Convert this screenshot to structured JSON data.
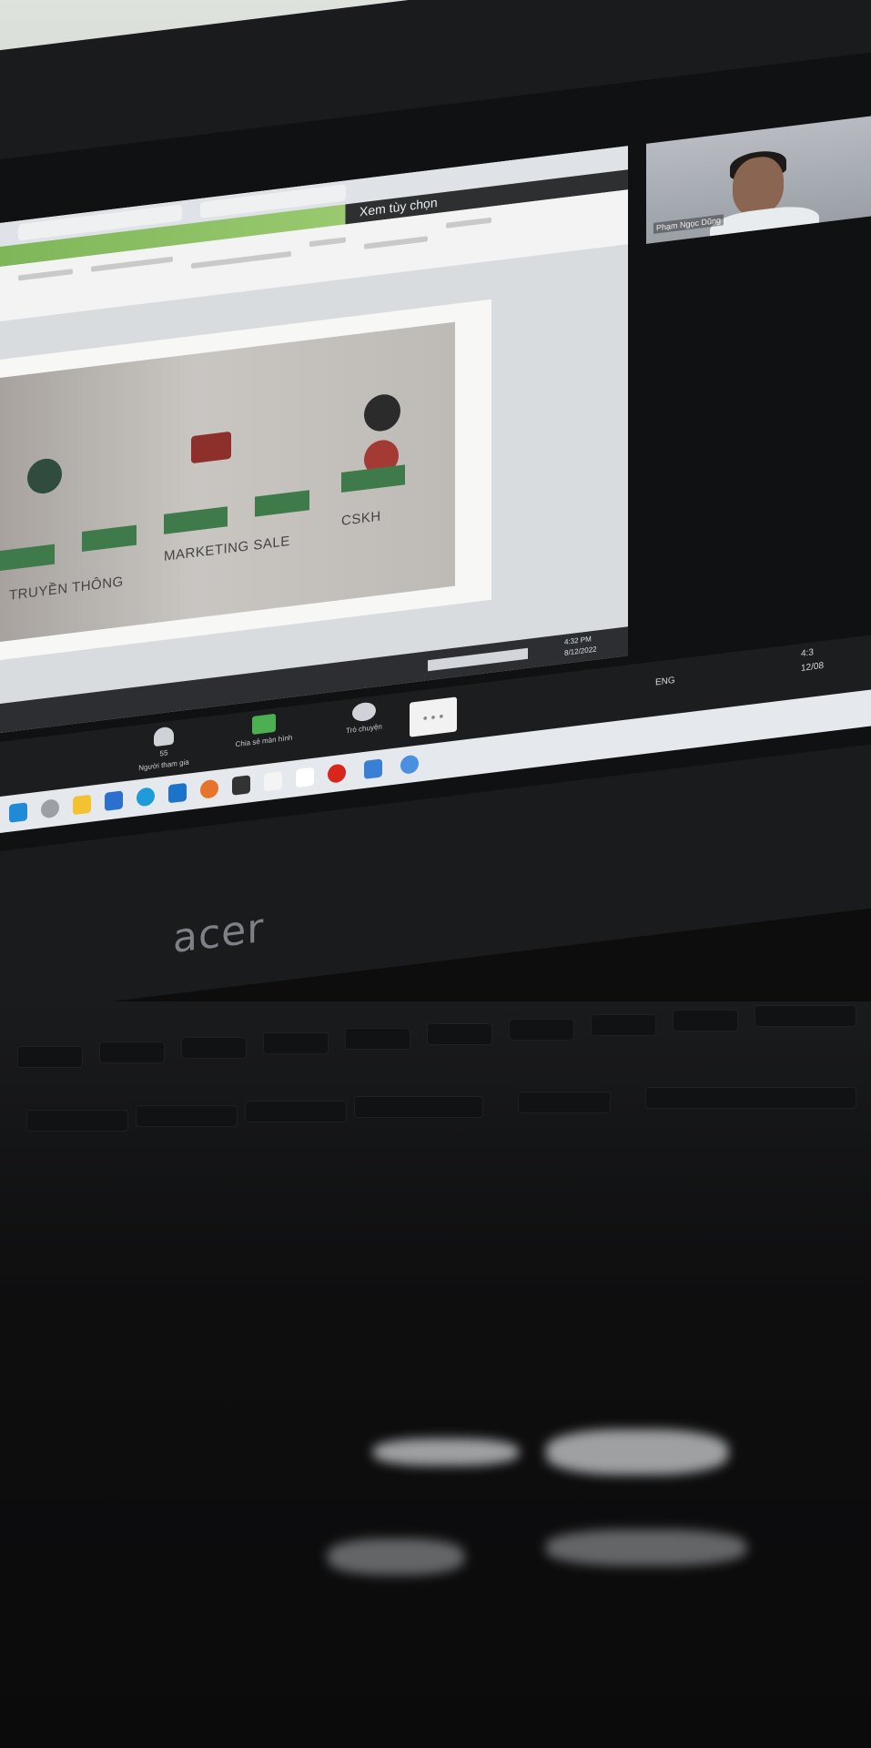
{
  "scene": {
    "brand_logo": "acer"
  },
  "share": {
    "view_label": "Xem tùy chọn",
    "slide": {
      "label_left": "TRUYỀN THÔNG",
      "label_mid": "MARKETING SALE",
      "label_right": "CSKH"
    },
    "status_time": "4:32 PM",
    "status_date": "8/12/2022"
  },
  "video": {
    "participant_name": "Phạm Ngọc Dũng"
  },
  "toolbar": {
    "participants_label": "Người tham gia",
    "participants_count": "55",
    "share_label": "Chia sẻ màn hình",
    "chat_label": "Trò chuyện",
    "more_label": "• • •"
  },
  "tray": {
    "lang": "ENG",
    "time": "4:3",
    "date": "12/08"
  },
  "colors": {
    "accent_green": "#3f7a4b",
    "leave_red": "#e8452b"
  }
}
